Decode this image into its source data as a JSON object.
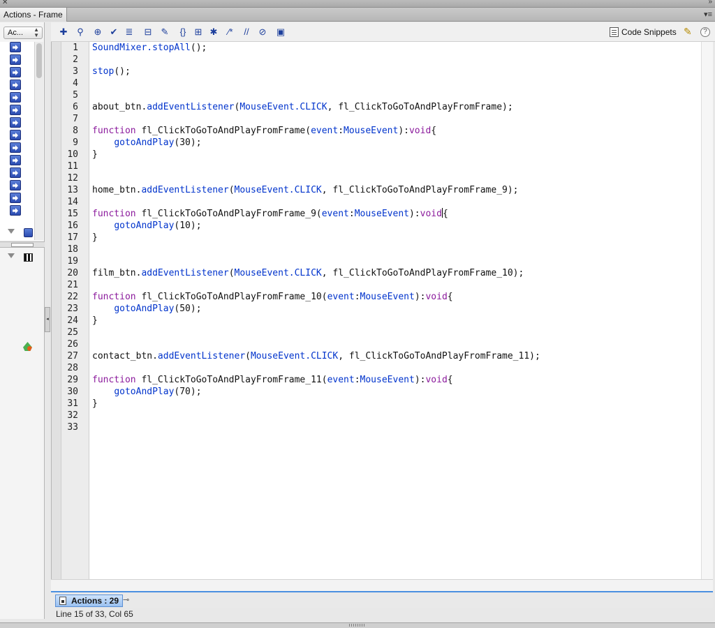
{
  "window": {
    "title": "Actions - Frame"
  },
  "toolbox": {
    "selected": "Ac..."
  },
  "toolbar": {
    "buttons": [
      {
        "name": "add-statement-button",
        "glyph": "✚"
      },
      {
        "name": "find-button",
        "glyph": "⚲"
      },
      {
        "name": "insert-target-path-button",
        "glyph": "⊕"
      },
      {
        "name": "check-syntax-button",
        "glyph": "✔"
      },
      {
        "name": "auto-format-button",
        "glyph": "≣"
      },
      {
        "name": "show-code-hint-button",
        "glyph": "⊟"
      },
      {
        "name": "debug-options-button",
        "glyph": "✎"
      },
      {
        "name": "collapse-between-braces-button",
        "glyph": "{}"
      },
      {
        "name": "collapse-selection-button",
        "glyph": "⊞"
      },
      {
        "name": "expand-all-button",
        "glyph": "✱"
      },
      {
        "name": "apply-block-comment-button",
        "glyph": "⁄*"
      },
      {
        "name": "apply-line-comment-button",
        "glyph": "//"
      },
      {
        "name": "remove-comment-button",
        "glyph": "⊘"
      },
      {
        "name": "show-hide-toolbox-button",
        "glyph": "▣"
      }
    ],
    "code_snippets_label": "Code Snippets",
    "help_label": "?"
  },
  "code": {
    "line_numbers": [
      "1",
      "2",
      "3",
      "4",
      "5",
      "6",
      "7",
      "8",
      "9",
      "10",
      "11",
      "12",
      "13",
      "14",
      "15",
      "16",
      "17",
      "18",
      "19",
      "20",
      "21",
      "22",
      "23",
      "24",
      "25",
      "26",
      "27",
      "28",
      "29",
      "30",
      "31",
      "32",
      "33"
    ],
    "lines": [
      {
        "n": 1,
        "parts": [
          [
            "kw",
            "SoundMixer.stopAll"
          ],
          [
            "",
            "();"
          ]
        ]
      },
      {
        "n": 2,
        "parts": []
      },
      {
        "n": 3,
        "parts": [
          [
            "kw",
            "stop"
          ],
          [
            "",
            "();"
          ]
        ]
      },
      {
        "n": 4,
        "parts": []
      },
      {
        "n": 5,
        "parts": []
      },
      {
        "n": 6,
        "parts": [
          [
            "",
            "about_btn."
          ],
          [
            "kw",
            "addEventListener"
          ],
          [
            "",
            "("
          ],
          [
            "kw",
            "MouseEvent.CLICK"
          ],
          [
            "",
            ", fl_ClickToGoToAndPlayFromFrame);"
          ]
        ]
      },
      {
        "n": 7,
        "parts": []
      },
      {
        "n": 8,
        "parts": [
          [
            "fn",
            "function"
          ],
          [
            "",
            " fl_ClickToGoToAndPlayFromFrame("
          ],
          [
            "kw",
            "event"
          ],
          [
            "",
            ":"
          ],
          [
            "kw",
            "MouseEvent"
          ],
          [
            "",
            "):"
          ],
          [
            "fn",
            "void"
          ],
          [
            "",
            "{"
          ]
        ]
      },
      {
        "n": 9,
        "parts": [
          [
            "",
            "    "
          ],
          [
            "kw",
            "gotoAndPlay"
          ],
          [
            "",
            "(30);"
          ]
        ]
      },
      {
        "n": 10,
        "parts": [
          [
            "",
            "}"
          ]
        ]
      },
      {
        "n": 11,
        "parts": []
      },
      {
        "n": 12,
        "parts": []
      },
      {
        "n": 13,
        "parts": [
          [
            "",
            "home_btn."
          ],
          [
            "kw",
            "addEventListener"
          ],
          [
            "",
            "("
          ],
          [
            "kw",
            "MouseEvent.CLICK"
          ],
          [
            "",
            ", fl_ClickToGoToAndPlayFromFrame_9);"
          ]
        ]
      },
      {
        "n": 14,
        "parts": []
      },
      {
        "n": 15,
        "parts": [
          [
            "fn",
            "function"
          ],
          [
            "",
            " fl_ClickToGoToAndPlayFromFrame_9("
          ],
          [
            "kw",
            "event"
          ],
          [
            "",
            ":"
          ],
          [
            "kw",
            "MouseEvent"
          ],
          [
            "",
            "):"
          ],
          [
            "fn",
            "void"
          ],
          [
            "caret",
            ""
          ],
          [
            "",
            "{"
          ]
        ]
      },
      {
        "n": 16,
        "parts": [
          [
            "",
            "    "
          ],
          [
            "kw",
            "gotoAndPlay"
          ],
          [
            "",
            "(10);"
          ]
        ]
      },
      {
        "n": 17,
        "parts": [
          [
            "",
            "}"
          ]
        ]
      },
      {
        "n": 18,
        "parts": []
      },
      {
        "n": 19,
        "parts": []
      },
      {
        "n": 20,
        "parts": [
          [
            "",
            "film_btn."
          ],
          [
            "kw",
            "addEventListener"
          ],
          [
            "",
            "("
          ],
          [
            "kw",
            "MouseEvent.CLICK"
          ],
          [
            "",
            ", fl_ClickToGoToAndPlayFromFrame_10);"
          ]
        ]
      },
      {
        "n": 21,
        "parts": []
      },
      {
        "n": 22,
        "parts": [
          [
            "fn",
            "function"
          ],
          [
            "",
            " fl_ClickToGoToAndPlayFromFrame_10("
          ],
          [
            "kw",
            "event"
          ],
          [
            "",
            ":"
          ],
          [
            "kw",
            "MouseEvent"
          ],
          [
            "",
            "):"
          ],
          [
            "fn",
            "void"
          ],
          [
            "",
            "{"
          ]
        ]
      },
      {
        "n": 23,
        "parts": [
          [
            "",
            "    "
          ],
          [
            "kw",
            "gotoAndPlay"
          ],
          [
            "",
            "(50);"
          ]
        ]
      },
      {
        "n": 24,
        "parts": [
          [
            "",
            "}"
          ]
        ]
      },
      {
        "n": 25,
        "parts": []
      },
      {
        "n": 26,
        "parts": []
      },
      {
        "n": 27,
        "parts": [
          [
            "",
            "contact_btn."
          ],
          [
            "kw",
            "addEventListener"
          ],
          [
            "",
            "("
          ],
          [
            "kw",
            "MouseEvent.CLICK"
          ],
          [
            "",
            ", fl_ClickToGoToAndPlayFromFrame_11);"
          ]
        ]
      },
      {
        "n": 28,
        "parts": []
      },
      {
        "n": 29,
        "parts": [
          [
            "fn",
            "function"
          ],
          [
            "",
            " fl_ClickToGoToAndPlayFromFrame_11("
          ],
          [
            "kw",
            "event"
          ],
          [
            "",
            ":"
          ],
          [
            "kw",
            "MouseEvent"
          ],
          [
            "",
            "):"
          ],
          [
            "fn",
            "void"
          ],
          [
            "",
            "{"
          ]
        ]
      },
      {
        "n": 30,
        "parts": [
          [
            "",
            "    "
          ],
          [
            "kw",
            "gotoAndPlay"
          ],
          [
            "",
            "(70);"
          ]
        ]
      },
      {
        "n": 31,
        "parts": [
          [
            "",
            "}"
          ]
        ]
      },
      {
        "n": 32,
        "parts": []
      },
      {
        "n": 33,
        "parts": []
      }
    ]
  },
  "bottom": {
    "tab_label": "Actions : 29",
    "status": "Line 15 of 33, Col 65"
  },
  "colors": {
    "keyword": "#0033cc",
    "reserved": "#8b1a9c",
    "tab_accent": "#4a8fe0"
  }
}
